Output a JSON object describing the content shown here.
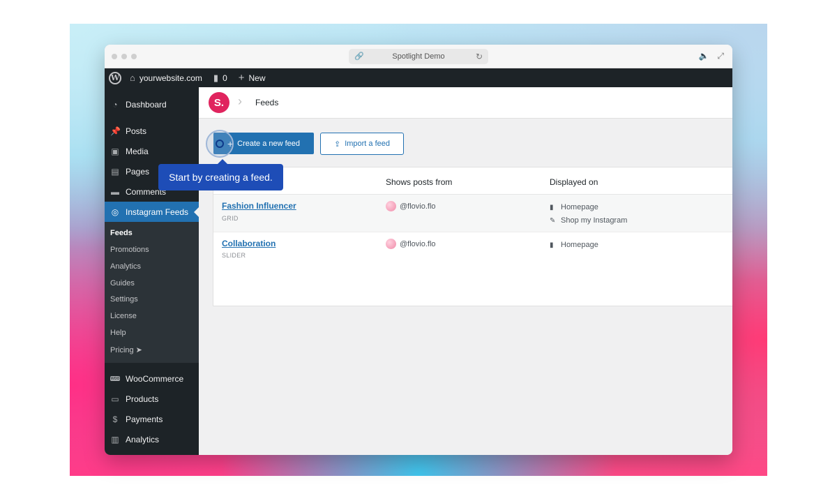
{
  "browser": {
    "url_title": "Spotlight Demo",
    "icons": {
      "link": "link-icon",
      "reload": "reload-icon",
      "sound": "speaker-icon",
      "expand": "expand-icon"
    }
  },
  "adminbar": {
    "site": "yourwebsite.com",
    "comments_count": "0",
    "new_label": "New"
  },
  "sidebar": {
    "items": [
      {
        "label": "Dashboard",
        "icon": "dashboard-icon"
      },
      {
        "label": "Posts",
        "icon": "pin-icon"
      },
      {
        "label": "Media",
        "icon": "media-icon"
      },
      {
        "label": "Pages",
        "icon": "pages-icon"
      },
      {
        "label": "Comments",
        "icon": "comment-icon"
      },
      {
        "label": "Instagram Feeds",
        "icon": "instagram-icon"
      }
    ],
    "submenu": [
      "Feeds",
      "Promotions",
      "Analytics",
      "Guides",
      "Settings",
      "License",
      "Help",
      "Pricing ➤"
    ],
    "bottom_items": [
      {
        "label": "WooCommerce",
        "icon": "woo-icon"
      },
      {
        "label": "Products",
        "icon": "archive-icon"
      },
      {
        "label": "Payments",
        "icon": "dollar-icon"
      },
      {
        "label": "Analytics",
        "icon": "bar-chart-icon"
      }
    ]
  },
  "topbar": {
    "brand": "S.",
    "title": "Feeds"
  },
  "actions": {
    "create": "Create a new feed",
    "import": "Import a feed"
  },
  "tooltip": "Start by creating a feed.",
  "table": {
    "headers": {
      "from": "Shows posts from",
      "displayed": "Displayed on"
    },
    "rows": [
      {
        "name": "Fashion Influencer",
        "type": "GRID",
        "account": "@flovio.flo",
        "displayed": [
          "Homepage",
          "Shop my Instagram"
        ]
      },
      {
        "name": "Collaboration",
        "type": "SLIDER",
        "account": "@flovio.flo",
        "displayed": [
          "Homepage"
        ]
      }
    ]
  }
}
